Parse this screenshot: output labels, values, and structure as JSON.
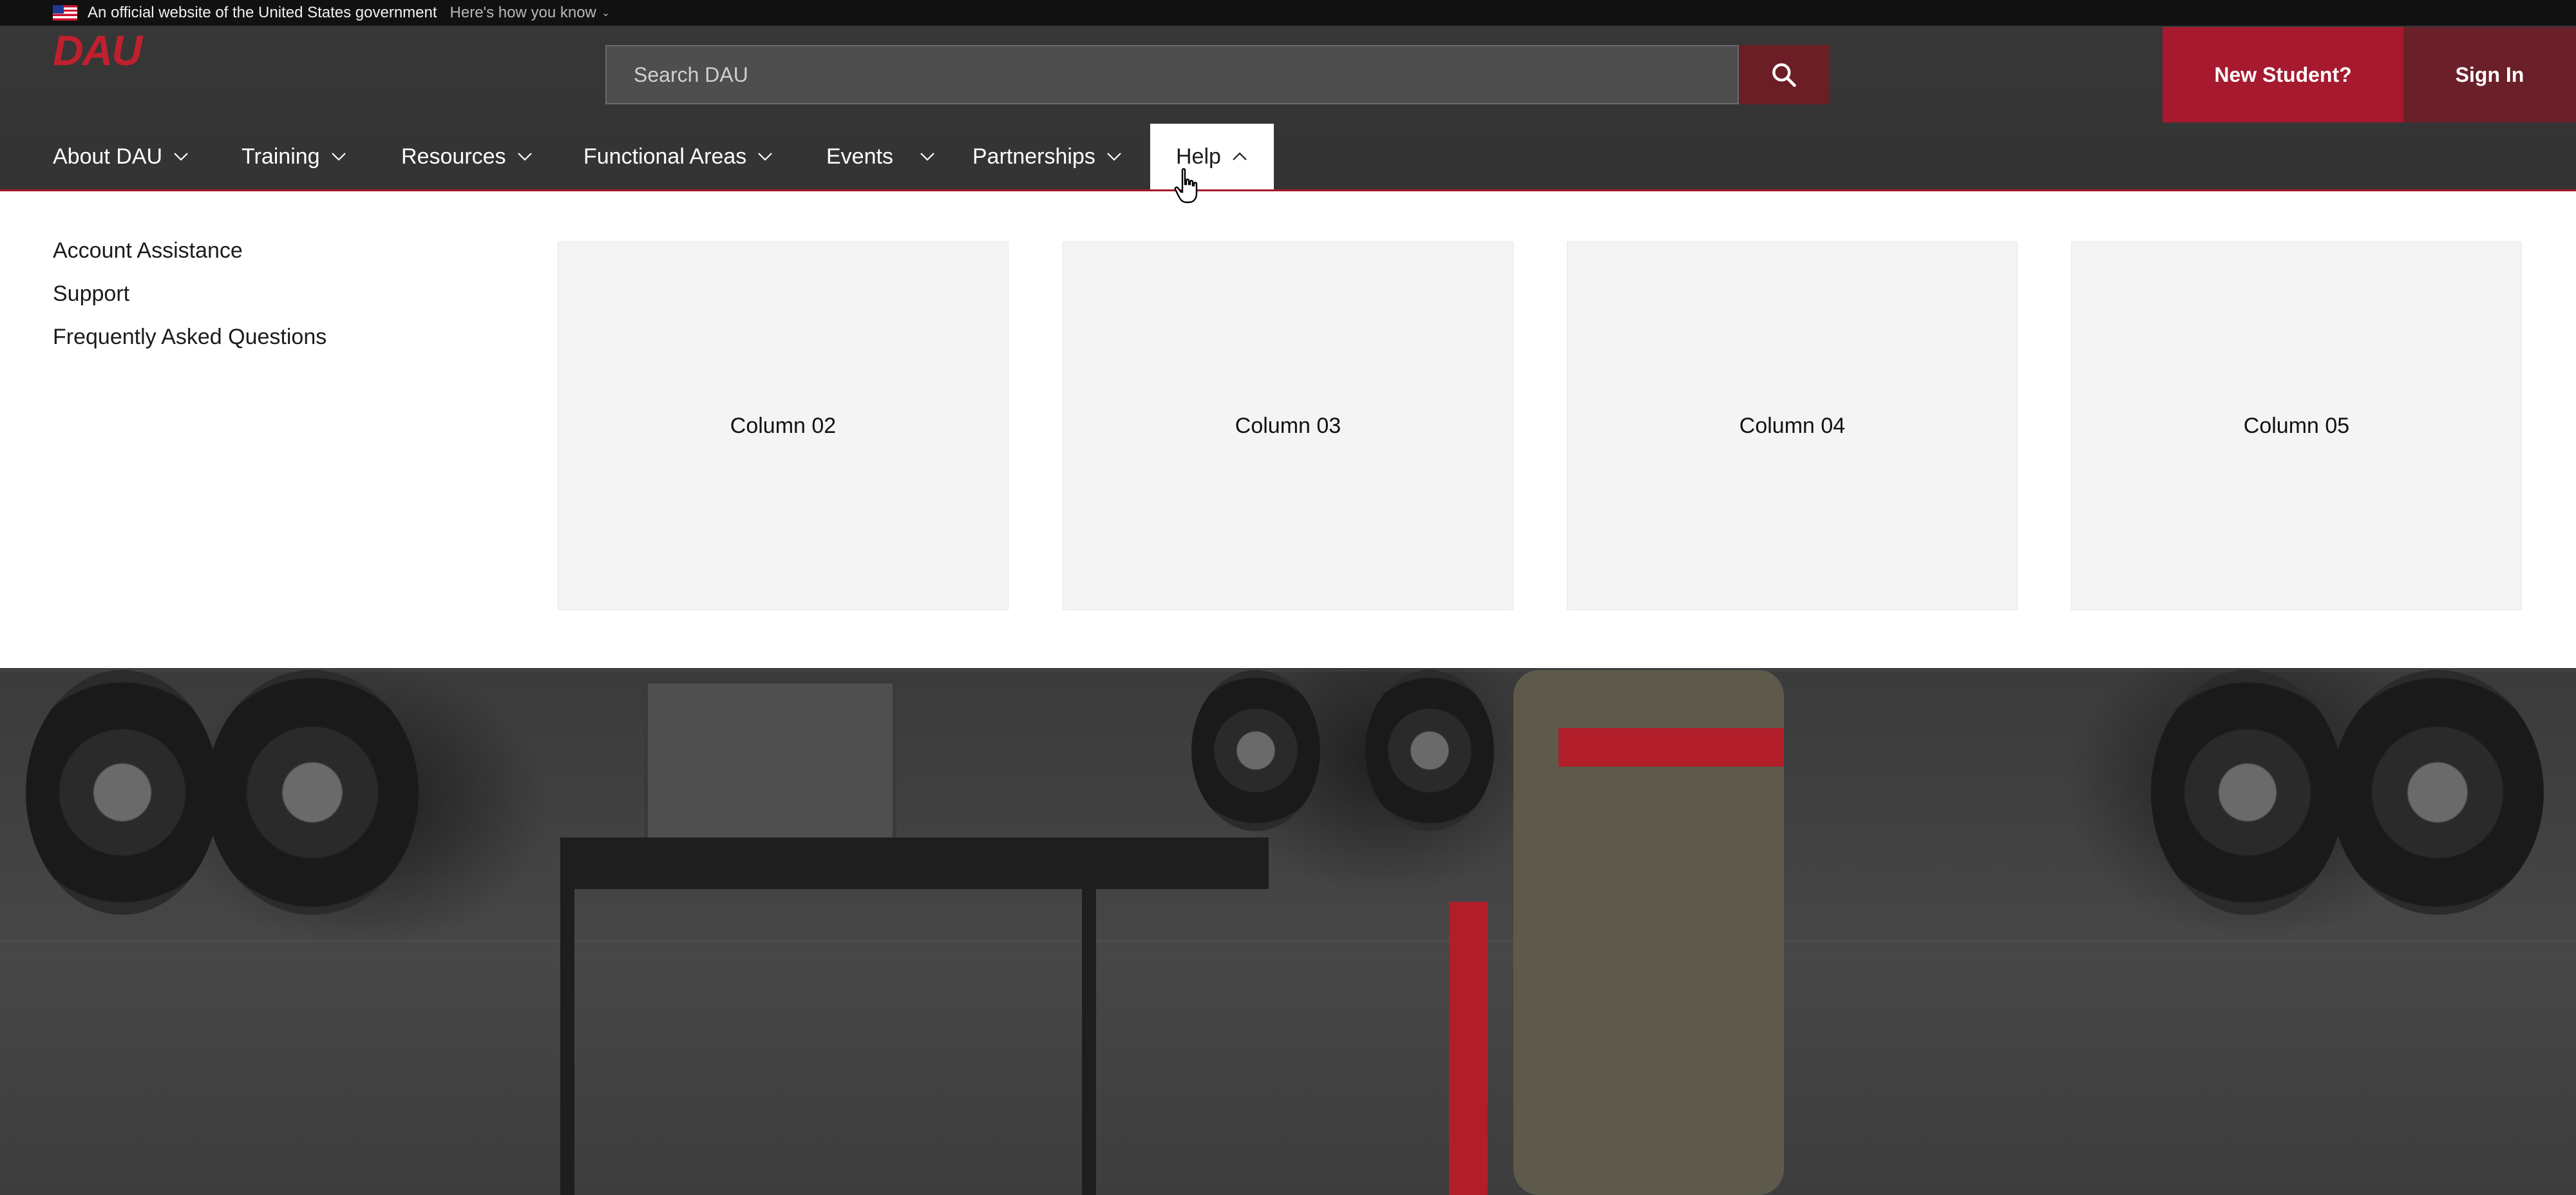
{
  "gov_banner": {
    "official_text": "An official website of the United States government",
    "how_you_know": "Here's how you know",
    "flag_icon": "us-flag-icon"
  },
  "header": {
    "logo": "DAU",
    "search": {
      "placeholder": "Search DAU",
      "value": "",
      "button_icon": "search-icon"
    },
    "new_student_label": "New Student?",
    "sign_in_label": "Sign In"
  },
  "nav": {
    "items": [
      {
        "label": "About DAU",
        "expanded": false
      },
      {
        "label": "Training",
        "expanded": false
      },
      {
        "label": "Resources",
        "expanded": false
      },
      {
        "label": "Functional Areas",
        "expanded": false
      },
      {
        "label": "Events",
        "expanded": false
      },
      {
        "label": "Partnerships",
        "expanded": false
      },
      {
        "label": "Help",
        "expanded": true
      }
    ]
  },
  "help_menu": {
    "links": [
      "Account Assistance",
      "Support",
      "Frequently Asked Questions"
    ],
    "columns": [
      "Column 02",
      "Column 03",
      "Column 04",
      "Column 05"
    ]
  },
  "colors": {
    "brand_red": "#a6192e",
    "dark_red": "#6b2029",
    "gov_banner_bg": "#111111",
    "menu_bg": "#ffffff",
    "column_bg": "#f4f4f4"
  }
}
